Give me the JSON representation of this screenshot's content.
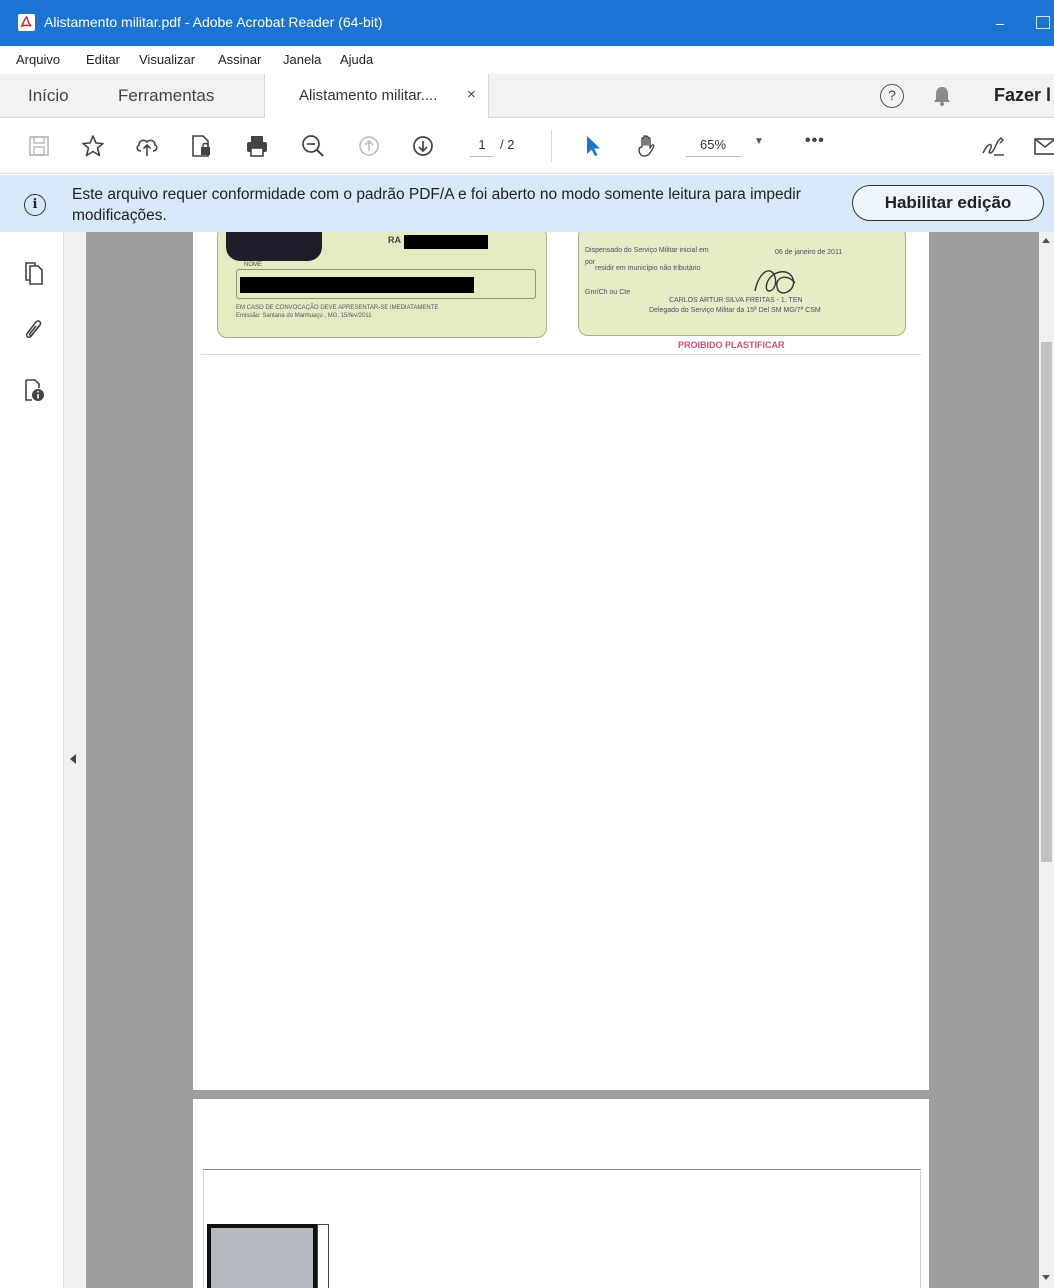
{
  "window": {
    "title": "Alistamento militar.pdf - Adobe Acrobat Reader (64-bit)",
    "minimize_glyph": "–"
  },
  "menu": {
    "items": [
      "Arquivo",
      "Editar",
      "Visualizar",
      "Assinar",
      "Janela",
      "Ajuda"
    ]
  },
  "tabs": {
    "home": "Início",
    "tools": "Ferramentas",
    "document": "Alistamento militar....",
    "close_glyph": "×",
    "help_glyph": "?",
    "signin": "Fazer l"
  },
  "toolbar": {
    "icons": [
      "save-icon",
      "bookmark-star-icon",
      "cloud-upload-icon",
      "file-protect-icon",
      "print-icon",
      "zoom-out-icon",
      "page-up-icon",
      "page-down-icon",
      "select-cursor-icon",
      "hand-tool-icon",
      "more-icon",
      "sign-icon",
      "share-icon"
    ],
    "page_current": "1",
    "page_total": "/ 2",
    "zoom": "65%",
    "more_glyph": "•••"
  },
  "banner": {
    "icon_glyph": "i",
    "message": "Este arquivo requer conformidade com o padrão PDF/A e foi aberto no modo somente leitura para impedir modificações.",
    "button": "Habilitar edição"
  },
  "left_panel": {
    "icons": [
      "pages-icon",
      "attachment-icon",
      "file-info-icon"
    ]
  },
  "document": {
    "card_left": {
      "ra": "RA",
      "nome": "NOME",
      "line1": "EM CASO DE CONVOCAÇÃO DEVE APRESENTAR-SE IMEDIATAMENTE",
      "line2": "Emissão: Santana do Manhuaçu , MG, 15/fev/2011"
    },
    "card_right": {
      "line1": "Dispensado do Serviço Militar inicial em",
      "date": "06 de janeiro de 2011",
      "line2": "por",
      "line3": "residir em município não tributário",
      "line4": "Gnr/Ch ou Cte",
      "signer": "CARLOS ARTUR SILVA FREITAS - 1. TEN",
      "role": "Delegado do Serviço Militar da 15ª Del SM MG/7ª CSM"
    },
    "stamp": "PROIBIDO PLASTIFICAR"
  },
  "colors": {
    "titlebar": "#1b73d3",
    "banner": "#d7e9f8",
    "viewer_bg": "#9e9e9e",
    "select_accent": "#1b73d3"
  }
}
